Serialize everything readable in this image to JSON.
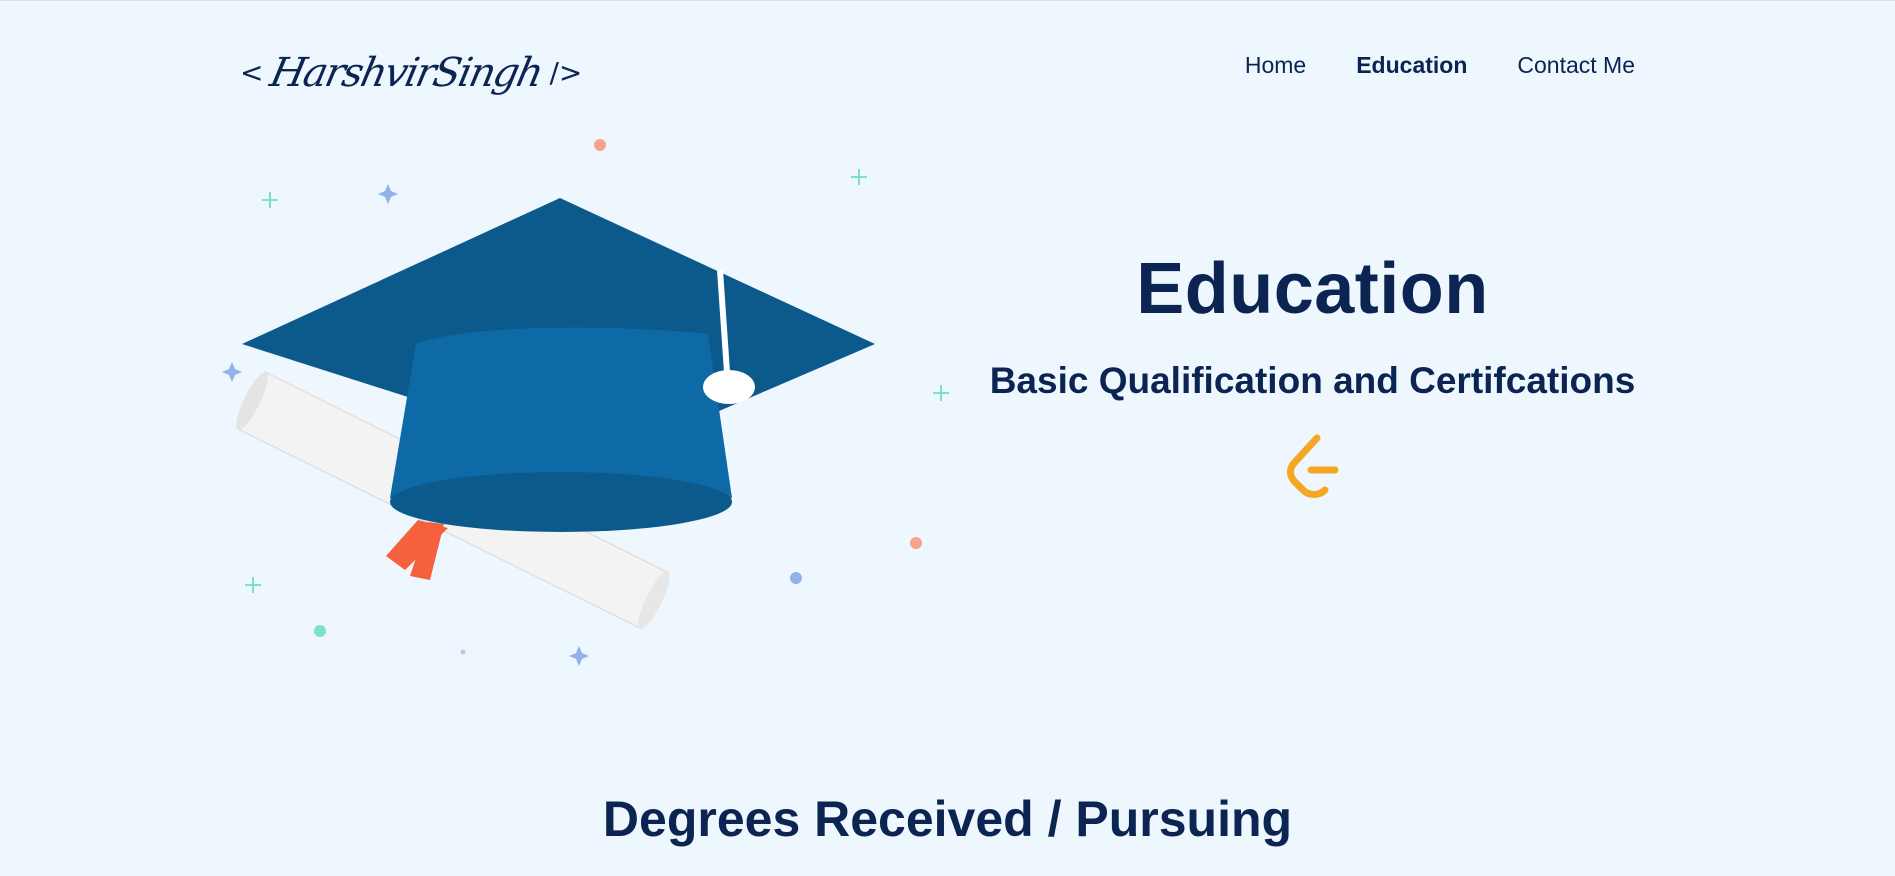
{
  "header": {
    "logo": {
      "open_bracket": "<",
      "signature": "HarshvirSingh",
      "close_bracket": "/>"
    },
    "nav": [
      {
        "label": "Home"
      },
      {
        "label": "Education",
        "active": true
      },
      {
        "label": "Contact Me"
      }
    ]
  },
  "hero": {
    "title": "Education",
    "subtitle": "Basic Qualification and Certifcations",
    "icon": "leetcode-icon",
    "illustration": "graduation-cap-and-diploma"
  },
  "section": {
    "title": "Degrees Received / Pursuing"
  },
  "colors": {
    "background": "#edf7fd",
    "text": "#0c2452",
    "cap_dark": "#0c5a8c",
    "cap_light": "#0e6aa6",
    "ribbon": "#f5603d",
    "leetcode": "#f5a623"
  }
}
